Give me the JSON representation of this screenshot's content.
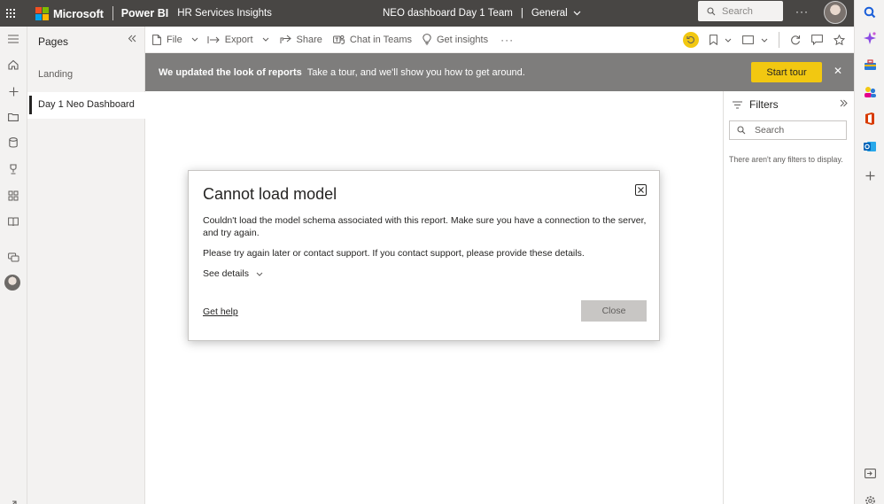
{
  "topbar": {
    "brand": "Microsoft",
    "product": "Power BI",
    "workspace": "HR Services Insights",
    "report_title": "NEO dashboard Day 1 Team",
    "separator": "|",
    "sensitivity": "General",
    "search_placeholder": "Search",
    "more": "···"
  },
  "pages_panel": {
    "title": "Pages",
    "pages": [
      {
        "label": "Landing",
        "active": false
      },
      {
        "label": "Day 1 Neo Dashboard",
        "active": true
      }
    ]
  },
  "toolbar": {
    "file": "File",
    "export": "Export",
    "share": "Share",
    "chat": "Chat in Teams",
    "insights": "Get insights",
    "more": "···"
  },
  "banner": {
    "headline": "We updated the look of reports",
    "message": "Take a tour, and we'll show you how to get around.",
    "tour_button": "Start tour",
    "close": "✕"
  },
  "filters": {
    "title": "Filters",
    "search_placeholder": "Search",
    "empty_message": "There aren't any filters to display."
  },
  "dialog": {
    "title": "Cannot load model",
    "message": "Couldn't load the model schema associated with this report. Make sure you have a connection to the server, and try again.",
    "support_message": "Please try again later or contact support. If you contact support, please provide these details.",
    "see_details": "See details",
    "get_help": "Get help",
    "close_button": "Close"
  },
  "colors": {
    "topbar_bg": "#484644",
    "accent_yellow": "#f2c811",
    "banner_bg": "#7e7d7c",
    "ms_logo": [
      "#f25022",
      "#7fba00",
      "#00a4ef",
      "#ffb900"
    ]
  }
}
